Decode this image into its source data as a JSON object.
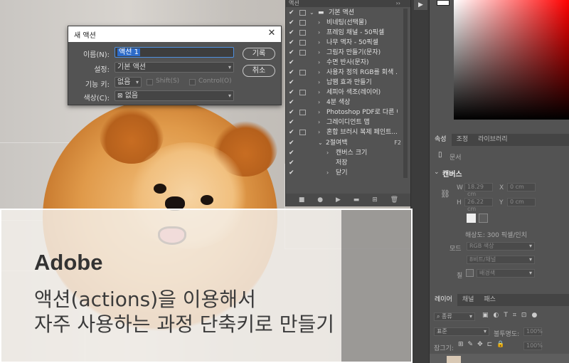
{
  "overlay": {
    "brand": "Adobe",
    "line1": "액션(actions)을 이용해서",
    "line2": "자주 사용하는 과정 단축키로 만들기"
  },
  "dialog": {
    "title": "새 액션",
    "name_label": "이름(N):",
    "name_value": "액션 1",
    "set_label": "설정:",
    "set_value": "기본 액션",
    "fkey_label": "기능 키:",
    "fkey_value": "없음",
    "shift_label": "Shift(S)",
    "control_label": "Control(O)",
    "color_label": "색상(C):",
    "color_value": "없음",
    "record_button": "기록",
    "cancel_button": "취소"
  },
  "actions_panel": {
    "header": "액션",
    "set_name": "기본 액션",
    "items": [
      "비네팅(선택물)",
      "프레임 채널 - 50픽셀",
      "나무 액자 - 50픽셀",
      "그림자 만들기(문자)",
      "수면 반사(문자)",
      "사용자 정의 RGB를 회색 ...",
      "납땜 효과 만들기",
      "세피아 색조(레이어)",
      "4분 색상",
      "Photoshop PDF로 다른 이...",
      "그레이디언트 맵",
      "혼합 브러시 복제 페인트..."
    ],
    "custom_action": "2절여백",
    "custom_action_key": "F2",
    "sub_items": [
      "캔버스 크기",
      "저장",
      "닫기"
    ]
  },
  "properties": {
    "tabs": [
      "속성",
      "조정",
      "라이브러리"
    ],
    "doc_label": "문서",
    "canvas_heading": "캔버스",
    "w_label": "W",
    "w_value": "18.29 cm",
    "h_label": "H",
    "h_value": "26.22 cm",
    "x_label": "X",
    "x_value": "0 cm",
    "y_label": "Y",
    "y_value": "0 cm",
    "resolution": "해상도: 300 픽셀/인치",
    "mode_label": "모드",
    "mode_value": "RGB 색상",
    "depth_value": "8비트/채널",
    "fill_label": "칠",
    "fill_value": "배경색"
  },
  "layers": {
    "tabs": [
      "레이어",
      "채널",
      "패스"
    ],
    "kind_value": "종류",
    "blend_value": "표준",
    "opacity_label": "불투명도:",
    "opacity_value": "100%",
    "lock_label": "잠그기:",
    "fill_value": "100%"
  },
  "colors": {
    "panel_bg": "#535353",
    "accent_selection": "#2d6bc9"
  }
}
